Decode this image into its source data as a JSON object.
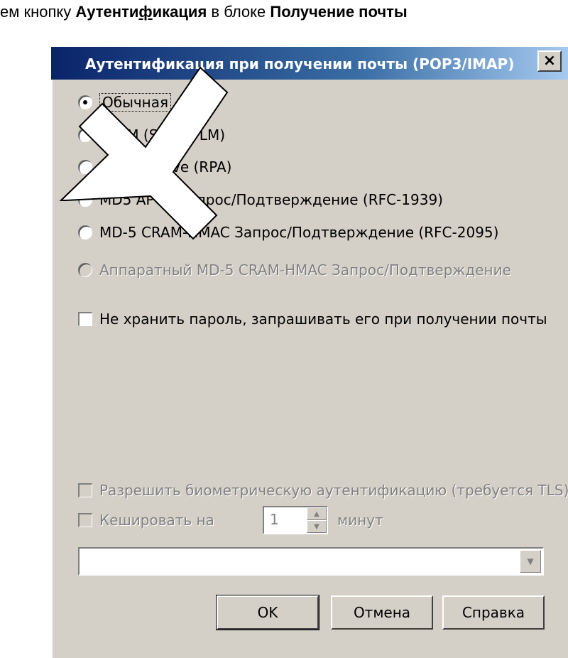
{
  "caption": {
    "prefix": "ем кнопку ",
    "button_part1": "Аутенти",
    "button_underlined": "ф",
    "button_part2": "икация",
    "middle": " в блоке ",
    "block": "Получение почты"
  },
  "dialog": {
    "title": "Аутентификация при получении почты (POP3/IMAP)",
    "close_glyph": "×"
  },
  "options": [
    {
      "label": "Обычная",
      "checked": true,
      "disabled": false
    },
    {
      "label": "NTLM (SPA/NTLM)",
      "checked": false,
      "disabled": false
    },
    {
      "label": "Compuserve (RPA)",
      "checked": false,
      "disabled": false
    },
    {
      "label": "MD5 APOP Запрос/Подтверждение (RFC-1939)",
      "checked": false,
      "disabled": false
    },
    {
      "label": "MD-5 CRAM-HMAC Запрос/Подтверждение (RFC-2095)",
      "checked": false,
      "disabled": false
    },
    {
      "label": "Аппаратный MD-5 CRAM-HMAC Запрос/Подтверждение",
      "checked": false,
      "disabled": true
    }
  ],
  "no_store_password": "Не хранить пароль, запрашивать его при получении почты",
  "biometric": "Разрешить биометрическую аутентификацию (требуется TLS)",
  "cache": {
    "label": "Кешировать на",
    "value": "1",
    "unit": "минут"
  },
  "combo": {
    "value": ""
  },
  "buttons": {
    "ok": "OK",
    "cancel": "Отмена",
    "help": "Справка"
  },
  "colors": {
    "title_bar": "#0a246a",
    "dialog_bg": "#d4d0c8",
    "disabled_text": "#808080"
  }
}
